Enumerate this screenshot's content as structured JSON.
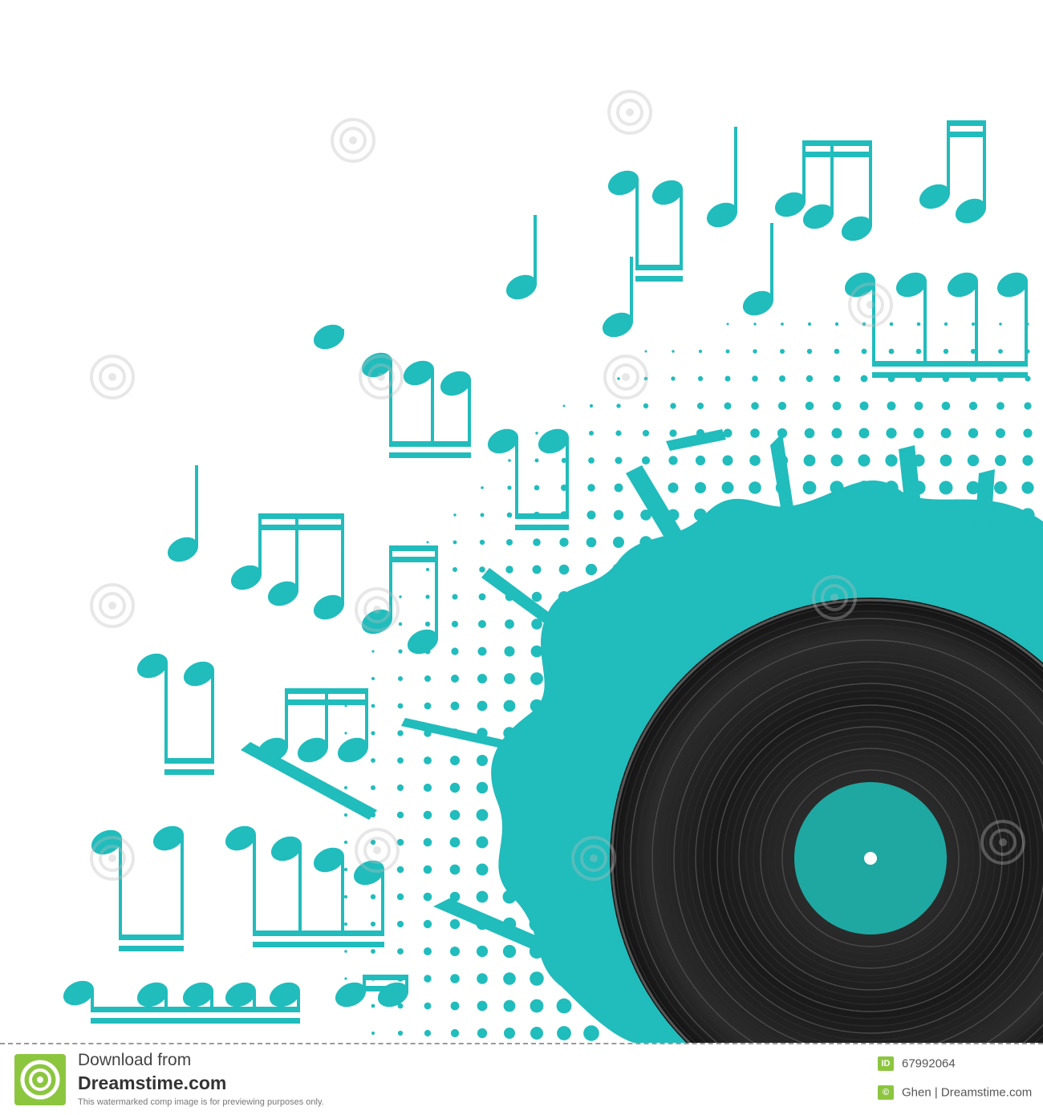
{
  "colors": {
    "teal": "#21bcbc",
    "label": "#1fa8a2",
    "vinyl": "#1a1a1a",
    "brand_green": "#8cc63f",
    "watermark": "#cfcfcf"
  },
  "watermark": {
    "text": "dreamstime"
  },
  "footer": {
    "download_line1": "Download from",
    "download_line2": "Dreamstime.com",
    "note": "This watermarked comp image is for previewing purposes only.",
    "id_tag": "ID",
    "id_value": "67992064",
    "credit_tag": "©",
    "credit": "Ghen | Dreamstime.com"
  },
  "icons": [
    "spiral-watermark-icon",
    "dreamstime-logo-icon"
  ]
}
